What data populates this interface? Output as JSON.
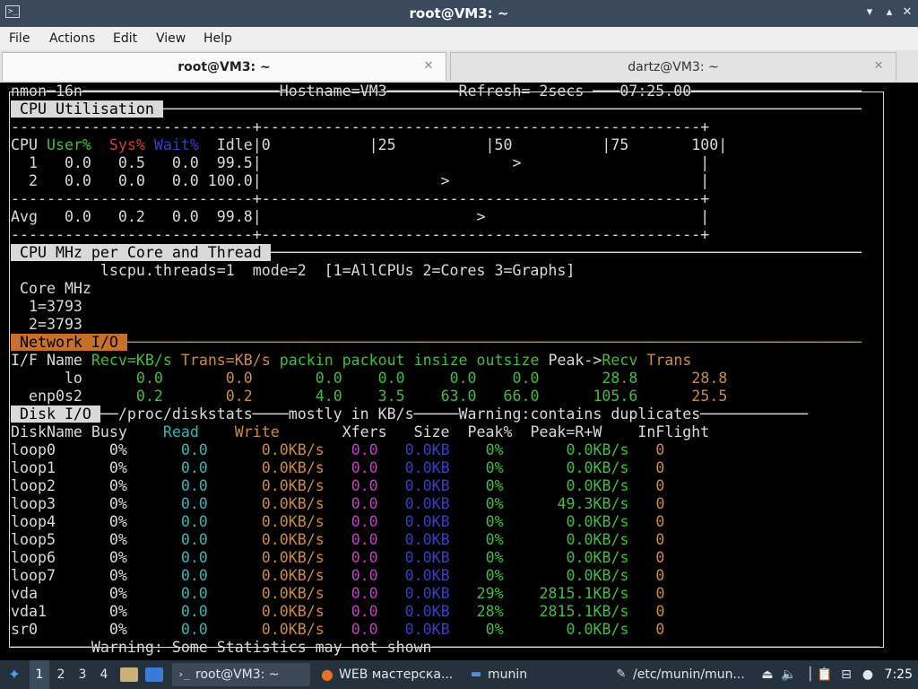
{
  "window": {
    "title": "root@VM3: ~",
    "minimize_glyph": "▾",
    "maximize_glyph": "▴",
    "close_glyph": "✕"
  },
  "menu": [
    "File",
    "Actions",
    "Edit",
    "View",
    "Help"
  ],
  "tabs": [
    {
      "label": "root@VM3: ~",
      "active": true
    },
    {
      "label": "dartz@VM3: ~",
      "active": false
    }
  ],
  "terminal": {
    "lines": [
      [
        [
          "w",
          "nmon─16n──────────────────────Hostname=VM3────────Refresh= 2secs ───07:25.00───────────────────"
        ]
      ],
      [
        [
          "hdr",
          " CPU Utilisation "
        ],
        [
          "w",
          "──────────────────────────────────────────────────────────────────────────────"
        ]
      ],
      [
        [
          "w",
          "---------------------------+-------------------------------------------------+"
        ]
      ],
      [
        [
          "w",
          "CPU "
        ],
        [
          "g",
          "User%"
        ],
        [
          "w",
          "  "
        ],
        [
          "r",
          "Sys%"
        ],
        [
          "w",
          " "
        ],
        [
          "b",
          "Wait%"
        ],
        [
          "w",
          "  Idle|0           |25          |50          |75       100|"
        ]
      ],
      [
        [
          "w",
          "  1   0.0   0.5   0.0  99.5|                            >                    |"
        ]
      ],
      [
        [
          "w",
          "  2   0.0   0.0   0.0 100.0|                    >                            |"
        ]
      ],
      [
        [
          "w",
          "---------------------------+-------------------------------------------------+"
        ]
      ],
      [
        [
          "w",
          "Avg   0.0   0.2   0.0  99.8|                        >                        |"
        ]
      ],
      [
        [
          "w",
          "---------------------------+-------------------------------------------------+"
        ]
      ],
      [
        [
          "hdr",
          " CPU MHz per Core and Thread "
        ],
        [
          "w",
          "──────────────────────────────────────────────────────────────────"
        ]
      ],
      [
        [
          "w",
          "          lscpu.threads=1  mode=2  [1=AllCPUs 2=Cores 3=Graphs]"
        ]
      ],
      [
        [
          "w",
          " Core MHz"
        ]
      ],
      [
        [
          "w",
          "  1=3793"
        ]
      ],
      [
        [
          "w",
          "  2=3793"
        ]
      ],
      [
        [
          "hdr-net",
          " Network I/O "
        ],
        [
          "o",
          "──────────────────────────────────────────────────────────────────────────────────"
        ]
      ],
      [
        [
          "w",
          "I/F Name "
        ],
        [
          "g",
          "Recv=KB/s"
        ],
        [
          "w",
          " "
        ],
        [
          "o",
          "Trans=KB/s"
        ],
        [
          "w",
          " "
        ],
        [
          "g",
          "packin packout insize outsize"
        ],
        [
          "w",
          " Peak->"
        ],
        [
          "g",
          "Recv"
        ],
        [
          "w",
          " "
        ],
        [
          "o",
          "Trans"
        ]
      ],
      [
        [
          "w",
          "      lo      "
        ],
        [
          "g",
          "0.0"
        ],
        [
          "w",
          "       "
        ],
        [
          "o",
          "0.0"
        ],
        [
          "w",
          "       "
        ],
        [
          "g",
          "0.0    0.0     0.0    0.0"
        ],
        [
          "w",
          "       "
        ],
        [
          "g",
          "28.8"
        ],
        [
          "w",
          "      "
        ],
        [
          "o",
          "28.8"
        ]
      ],
      [
        [
          "w",
          "  enp0s2      "
        ],
        [
          "g",
          "0.2"
        ],
        [
          "w",
          "       "
        ],
        [
          "o",
          "0.2"
        ],
        [
          "w",
          "       "
        ],
        [
          "g",
          "4.0    3.5    63.0   66.0"
        ],
        [
          "w",
          "      "
        ],
        [
          "g",
          "105.6"
        ],
        [
          "w",
          "      "
        ],
        [
          "o",
          "25.5"
        ]
      ],
      [
        [
          "hdr",
          " Disk I/O "
        ],
        [
          "w",
          "──/proc/diskstats────mostly in KB/s─────Warning:contains duplicates────────────"
        ]
      ],
      [
        [
          "w",
          "DiskName Busy    "
        ],
        [
          "c",
          "Read"
        ],
        [
          "w",
          "    "
        ],
        [
          "o",
          "Write"
        ],
        [
          "w",
          "       Xfers   Size  Peak%  Peak=R+W    InFlight"
        ]
      ],
      [
        [
          "w",
          "loop0      0%      "
        ],
        [
          "c",
          "0.0"
        ],
        [
          "w",
          "      "
        ],
        [
          "o",
          "0.0KB/s"
        ],
        [
          "w",
          "   "
        ],
        [
          "m",
          "0.0"
        ],
        [
          "w",
          "   "
        ],
        [
          "bb",
          "0.0KB"
        ],
        [
          "w",
          "    "
        ],
        [
          "g",
          "0%"
        ],
        [
          "w",
          "       "
        ],
        [
          "g",
          "0.0KB/s"
        ],
        [
          "w",
          "   "
        ],
        [
          "o",
          "0"
        ]
      ],
      [
        [
          "w",
          "loop1      0%      "
        ],
        [
          "c",
          "0.0"
        ],
        [
          "w",
          "      "
        ],
        [
          "o",
          "0.0KB/s"
        ],
        [
          "w",
          "   "
        ],
        [
          "m",
          "0.0"
        ],
        [
          "w",
          "   "
        ],
        [
          "bb",
          "0.0KB"
        ],
        [
          "w",
          "    "
        ],
        [
          "g",
          "0%"
        ],
        [
          "w",
          "       "
        ],
        [
          "g",
          "0.0KB/s"
        ],
        [
          "w",
          "   "
        ],
        [
          "o",
          "0"
        ]
      ],
      [
        [
          "w",
          "loop2      0%      "
        ],
        [
          "c",
          "0.0"
        ],
        [
          "w",
          "      "
        ],
        [
          "o",
          "0.0KB/s"
        ],
        [
          "w",
          "   "
        ],
        [
          "m",
          "0.0"
        ],
        [
          "w",
          "   "
        ],
        [
          "bb",
          "0.0KB"
        ],
        [
          "w",
          "    "
        ],
        [
          "g",
          "0%"
        ],
        [
          "w",
          "       "
        ],
        [
          "g",
          "0.0KB/s"
        ],
        [
          "w",
          "   "
        ],
        [
          "o",
          "0"
        ]
      ],
      [
        [
          "w",
          "loop3      0%      "
        ],
        [
          "c",
          "0.0"
        ],
        [
          "w",
          "      "
        ],
        [
          "o",
          "0.0KB/s"
        ],
        [
          "w",
          "   "
        ],
        [
          "m",
          "0.0"
        ],
        [
          "w",
          "   "
        ],
        [
          "bb",
          "0.0KB"
        ],
        [
          "w",
          "    "
        ],
        [
          "g",
          "0%"
        ],
        [
          "w",
          "      "
        ],
        [
          "g",
          "49.3KB/s"
        ],
        [
          "w",
          "   "
        ],
        [
          "o",
          "0"
        ]
      ],
      [
        [
          "w",
          "loop4      0%      "
        ],
        [
          "c",
          "0.0"
        ],
        [
          "w",
          "      "
        ],
        [
          "o",
          "0.0KB/s"
        ],
        [
          "w",
          "   "
        ],
        [
          "m",
          "0.0"
        ],
        [
          "w",
          "   "
        ],
        [
          "bb",
          "0.0KB"
        ],
        [
          "w",
          "    "
        ],
        [
          "g",
          "0%"
        ],
        [
          "w",
          "       "
        ],
        [
          "g",
          "0.0KB/s"
        ],
        [
          "w",
          "   "
        ],
        [
          "o",
          "0"
        ]
      ],
      [
        [
          "w",
          "loop5      0%      "
        ],
        [
          "c",
          "0.0"
        ],
        [
          "w",
          "      "
        ],
        [
          "o",
          "0.0KB/s"
        ],
        [
          "w",
          "   "
        ],
        [
          "m",
          "0.0"
        ],
        [
          "w",
          "   "
        ],
        [
          "bb",
          "0.0KB"
        ],
        [
          "w",
          "    "
        ],
        [
          "g",
          "0%"
        ],
        [
          "w",
          "       "
        ],
        [
          "g",
          "0.0KB/s"
        ],
        [
          "w",
          "   "
        ],
        [
          "o",
          "0"
        ]
      ],
      [
        [
          "w",
          "loop6      0%      "
        ],
        [
          "c",
          "0.0"
        ],
        [
          "w",
          "      "
        ],
        [
          "o",
          "0.0KB/s"
        ],
        [
          "w",
          "   "
        ],
        [
          "m",
          "0.0"
        ],
        [
          "w",
          "   "
        ],
        [
          "bb",
          "0.0KB"
        ],
        [
          "w",
          "    "
        ],
        [
          "g",
          "0%"
        ],
        [
          "w",
          "       "
        ],
        [
          "g",
          "0.0KB/s"
        ],
        [
          "w",
          "   "
        ],
        [
          "o",
          "0"
        ]
      ],
      [
        [
          "w",
          "loop7      0%      "
        ],
        [
          "c",
          "0.0"
        ],
        [
          "w",
          "      "
        ],
        [
          "o",
          "0.0KB/s"
        ],
        [
          "w",
          "   "
        ],
        [
          "m",
          "0.0"
        ],
        [
          "w",
          "   "
        ],
        [
          "bb",
          "0.0KB"
        ],
        [
          "w",
          "    "
        ],
        [
          "g",
          "0%"
        ],
        [
          "w",
          "       "
        ],
        [
          "g",
          "0.0KB/s"
        ],
        [
          "w",
          "   "
        ],
        [
          "o",
          "0"
        ]
      ],
      [
        [
          "w",
          "vda        0%      "
        ],
        [
          "c",
          "0.0"
        ],
        [
          "w",
          "      "
        ],
        [
          "o",
          "0.0KB/s"
        ],
        [
          "w",
          "   "
        ],
        [
          "m",
          "0.0"
        ],
        [
          "w",
          "   "
        ],
        [
          "bb",
          "0.0KB"
        ],
        [
          "w",
          "   "
        ],
        [
          "g",
          "29%"
        ],
        [
          "w",
          "    "
        ],
        [
          "g",
          "2815.1KB/s"
        ],
        [
          "w",
          "   "
        ],
        [
          "o",
          "0"
        ]
      ],
      [
        [
          "w",
          "vda1       0%      "
        ],
        [
          "c",
          "0.0"
        ],
        [
          "w",
          "      "
        ],
        [
          "o",
          "0.0KB/s"
        ],
        [
          "w",
          "   "
        ],
        [
          "m",
          "0.0"
        ],
        [
          "w",
          "   "
        ],
        [
          "bb",
          "0.0KB"
        ],
        [
          "w",
          "   "
        ],
        [
          "g",
          "28%"
        ],
        [
          "w",
          "    "
        ],
        [
          "g",
          "2815.1KB/s"
        ],
        [
          "w",
          "   "
        ],
        [
          "o",
          "0"
        ]
      ],
      [
        [
          "w",
          "sr0        0%      "
        ],
        [
          "c",
          "0.0"
        ],
        [
          "w",
          "      "
        ],
        [
          "o",
          "0.0KB/s"
        ],
        [
          "w",
          "   "
        ],
        [
          "m",
          "0.0"
        ],
        [
          "w",
          "   "
        ],
        [
          "bb",
          "0.0KB"
        ],
        [
          "w",
          "    "
        ],
        [
          "g",
          "0%"
        ],
        [
          "w",
          "       "
        ],
        [
          "g",
          "0.0KB/s"
        ],
        [
          "w",
          "   "
        ],
        [
          "o",
          "0"
        ]
      ],
      [
        [
          "w",
          "─────────Warning: Some Statistics may not shown──────────────────────────────────────────────────"
        ]
      ]
    ]
  },
  "taskbar": {
    "workspaces": [
      "1",
      "2",
      "3",
      "4"
    ],
    "active_workspace": "1",
    "tasks": [
      {
        "label": "root@VM3: ~",
        "icon": "terminal-icon",
        "glyph": "›_",
        "active": true
      },
      {
        "label": "WEB мастерска...",
        "icon": "firefox-icon",
        "glyph": "●",
        "active": false
      },
      {
        "label": "munin",
        "icon": "folder-icon",
        "glyph": "▬",
        "active": false
      },
      {
        "label": "/etc/munin/mun...",
        "icon": "text-editor-icon",
        "glyph": "✎",
        "active": false
      }
    ],
    "clock": "7:25",
    "colors": {
      "taskbar_bg": "#25313d",
      "title_bg": "#3a4a5c",
      "nmon_green": "#3fbf3f",
      "nmon_orange": "#d08a3a"
    }
  }
}
